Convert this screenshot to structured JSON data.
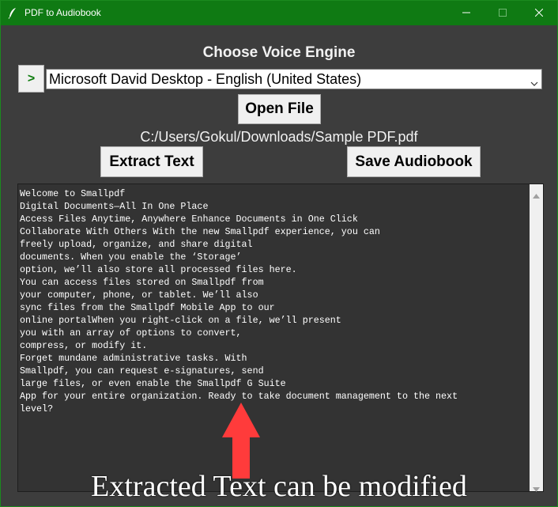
{
  "window": {
    "title": "PDF to Audiobook",
    "icon": "feather-icon",
    "controls": [
      "minimize-icon",
      "maximize-icon",
      "close-icon"
    ],
    "accent": "#0f7a13"
  },
  "voice": {
    "heading": "Choose Voice Engine",
    "arrow_label": ">",
    "selected": "Microsoft David Desktop - English (United States)"
  },
  "file": {
    "open_label": "Open File",
    "path": "C:/Users/Gokul/Downloads/Sample PDF.pdf"
  },
  "actions": {
    "extract_label": "Extract Text",
    "save_label": "Save Audiobook"
  },
  "text_area": {
    "content": "Welcome to Smallpdf\nDigital Documents—All In One Place\nAccess Files Anytime, Anywhere Enhance Documents in One Click\nCollaborate With Others With the new Smallpdf experience, you can\nfreely upload, organize, and share digital\ndocuments. When you enable the ‘Storage’\noption, we’ll also store all processed files here.\nYou can access files stored on Smallpdf from\nyour computer, phone, or tablet. We’ll also\nsync files from the Smallpdf Mobile App to our\nonline portalWhen you right-click on a file, we’ll present\nyou with an array of options to convert,\ncompress, or modify it.\nForget mundane administrative tasks. With\nSmallpdf, you can request e-signatures, send\nlarge files, or even enable the Smallpdf G Suite\nApp for your entire organization. Ready to take document management to the next\nlevel?"
  },
  "annotation": {
    "text": "Extracted Text can be modified",
    "arrow_color": "#ff3b3b"
  }
}
